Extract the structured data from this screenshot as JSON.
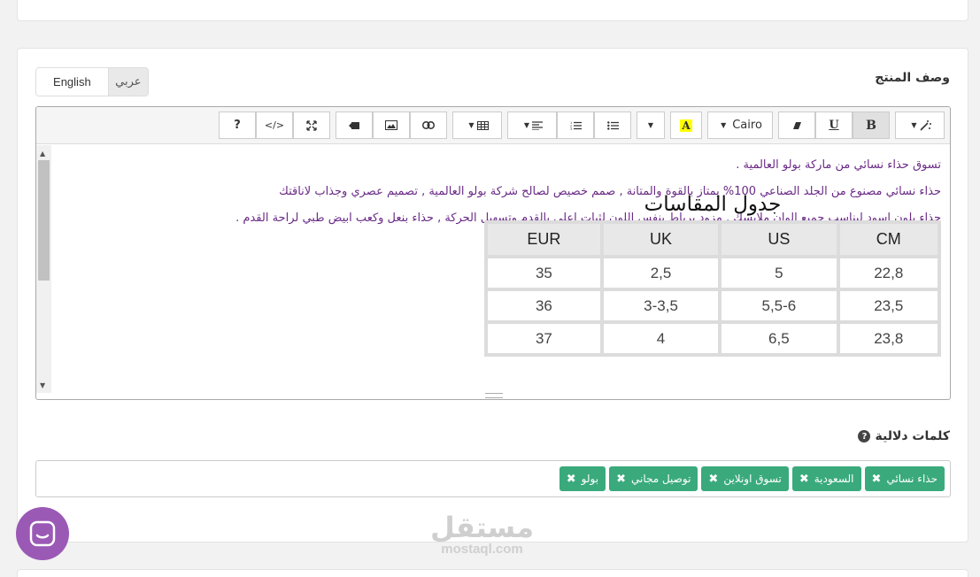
{
  "language_tabs": {
    "english": "English",
    "arabic": "عربي"
  },
  "description_section": {
    "title": "وصف المنتج"
  },
  "editor": {
    "toolbar": {
      "font_family": "Cairo",
      "help_label": "?",
      "code_label": "</>",
      "bold_label": "B",
      "underline_label": "U",
      "color_label": "A"
    },
    "paragraphs": [
      "تسوق حذاء نسائي من ماركة بولو العالمية .",
      "حذاء نسائي مصنوع من الجلد الصناعي 100% يمتاز بالقوة والمتانة , صمم خصيص لصالح شركة بولو العالمية , تصميم عصري وجذاب لاناقتك",
      "حذاء بلون اسود ليناسب جميع الوان ملابسك , مزود برباط بنفس اللون لثبات اعلى بالقدم وتسهيل الحركة , حذاء بنعل وكعب ابيض طبي لراحة القدم ."
    ],
    "size_chart": {
      "title": "جدول المقاسات",
      "headers": [
        "EUR",
        "UK",
        "US",
        "CM"
      ],
      "rows": [
        [
          "35",
          "2,5",
          "5",
          "22,8"
        ],
        [
          "36",
          "3-3,5",
          "5,5-6",
          "23,5"
        ],
        [
          "37",
          "4",
          "6,5",
          "23,8"
        ]
      ]
    }
  },
  "keywords_section": {
    "title": "كلمات دلالية",
    "help_icon": "?",
    "tags": [
      "حذاء نسائي",
      "السعودية",
      "تسوق اونلاين",
      "توصيل مجاني",
      "بولو"
    ],
    "remove_glyph": "✖"
  },
  "watermark": {
    "arabic": "مستقل",
    "latin": "mostaql.com"
  },
  "colors": {
    "tag": "#3aaa7c",
    "text_purple": "#6a2a86",
    "chat_bubble": "#9b59b6"
  }
}
